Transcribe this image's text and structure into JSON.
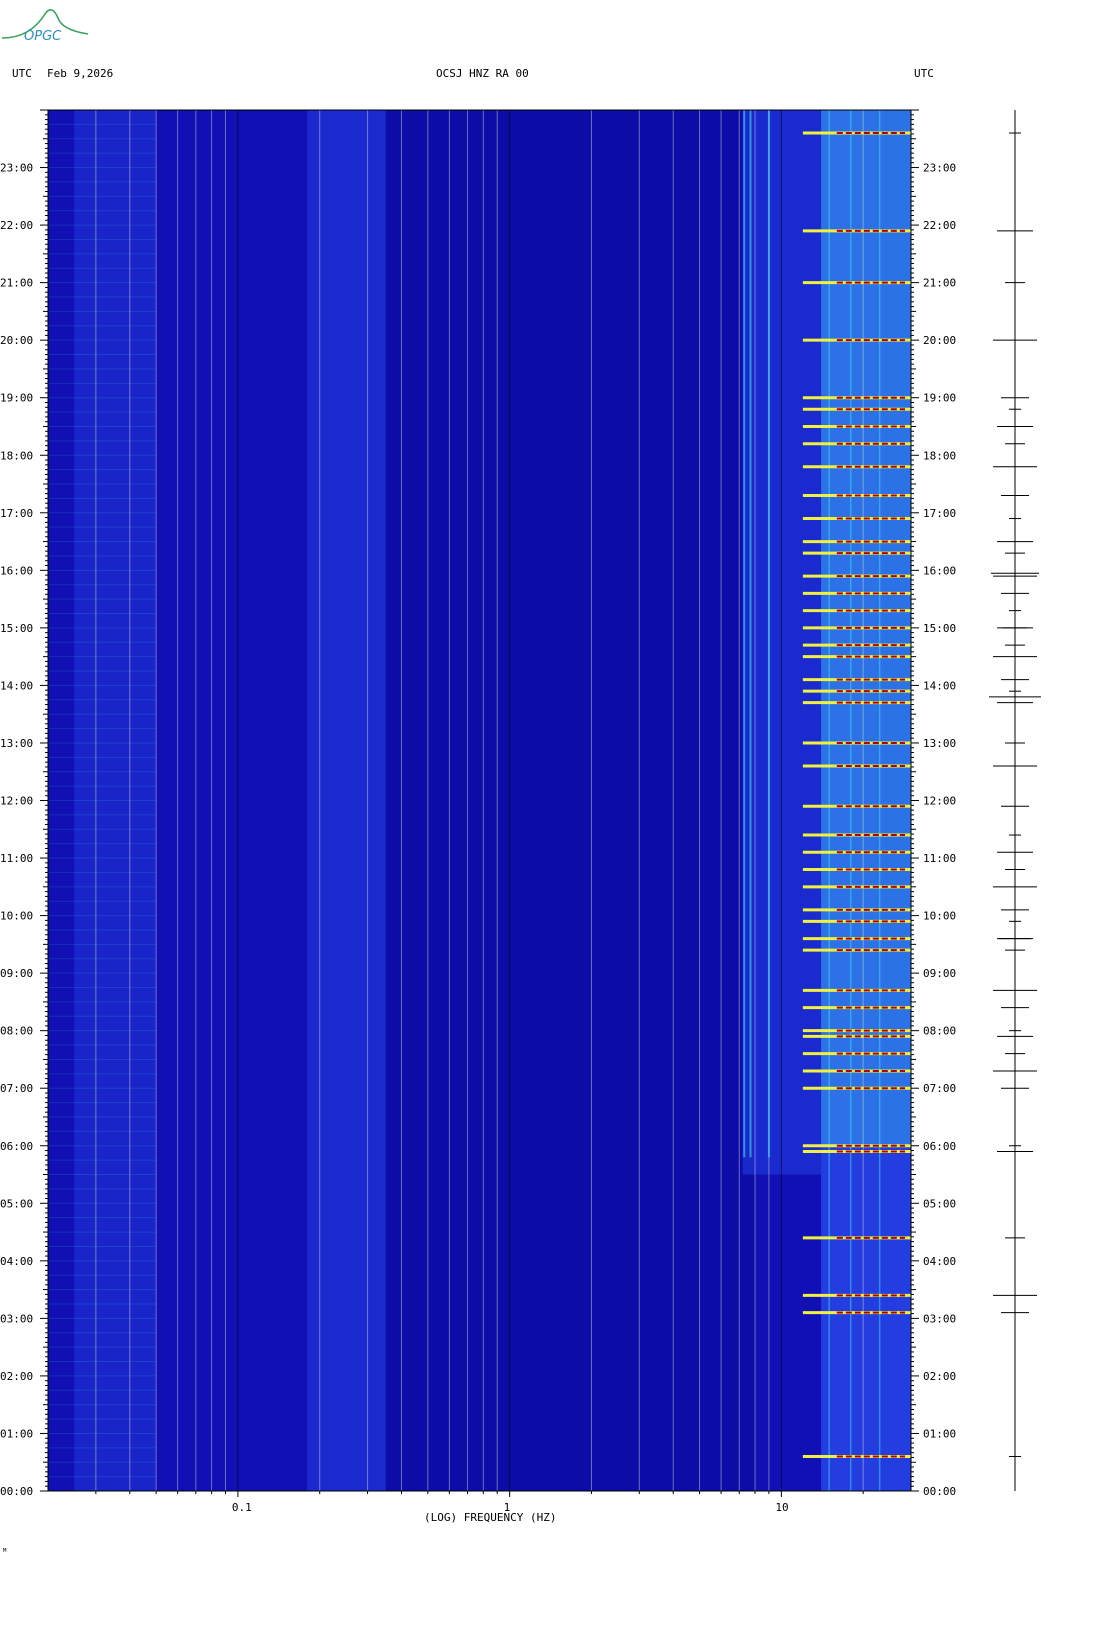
{
  "header": {
    "left_label": "UTC",
    "date": "Feb 9,2026",
    "station": "OCSJ HNZ RA 00",
    "right_label": "UTC"
  },
  "logo": {
    "text": "OPGC",
    "color": "#3aa35a"
  },
  "footer_mark": "ᴹ",
  "chart_data": {
    "type": "heatmap",
    "title": "OCSJ HNZ RA 00",
    "xlabel": "(LOG) FREQUENCY (HZ)",
    "ylabel": "",
    "x_scale": "log",
    "xlim": [
      0.02,
      30
    ],
    "x_ticks": [
      {
        "value": 0.1,
        "label": "0.1"
      },
      {
        "value": 1,
        "label": "1"
      },
      {
        "value": 10,
        "label": "10"
      }
    ],
    "ylim_hours": [
      0,
      24
    ],
    "y_ticks": [
      "00:00",
      "01:00",
      "02:00",
      "03:00",
      "04:00",
      "05:00",
      "06:00",
      "07:00",
      "08:00",
      "09:00",
      "10:00",
      "11:00",
      "12:00",
      "13:00",
      "14:00",
      "15:00",
      "16:00",
      "17:00",
      "18:00",
      "19:00",
      "20:00",
      "21:00",
      "22:00",
      "23:00"
    ],
    "colors": {
      "background": "#1010b4",
      "low": "#0a0aa0",
      "mid": "#2a4cf0",
      "high_cyan": "#40d8f0",
      "yellow": "#f0f040",
      "red": "#b00000"
    },
    "vertical_gridlines_hz": [
      0.03,
      0.04,
      0.05,
      0.06,
      0.07,
      0.08,
      0.09,
      0.1,
      0.2,
      0.3,
      0.4,
      0.5,
      0.6,
      0.7,
      0.8,
      0.9,
      1,
      2,
      3,
      4,
      5,
      6,
      7,
      8,
      9,
      10,
      20
    ],
    "event_hours": [
      0.6,
      3.1,
      3.4,
      4.4,
      5.9,
      6.0,
      7.0,
      7.3,
      7.6,
      7.9,
      8.0,
      8.4,
      8.7,
      9.4,
      9.6,
      9.9,
      10.1,
      10.5,
      10.8,
      11.1,
      11.4,
      11.9,
      12.6,
      13.0,
      13.7,
      13.9,
      14.1,
      14.5,
      14.7,
      15.0,
      15.3,
      15.6,
      15.9,
      16.3,
      16.5,
      16.9,
      17.3,
      17.8,
      18.2,
      18.5,
      18.8,
      19.0,
      20.0,
      21.0,
      21.9,
      23.6
    ]
  }
}
